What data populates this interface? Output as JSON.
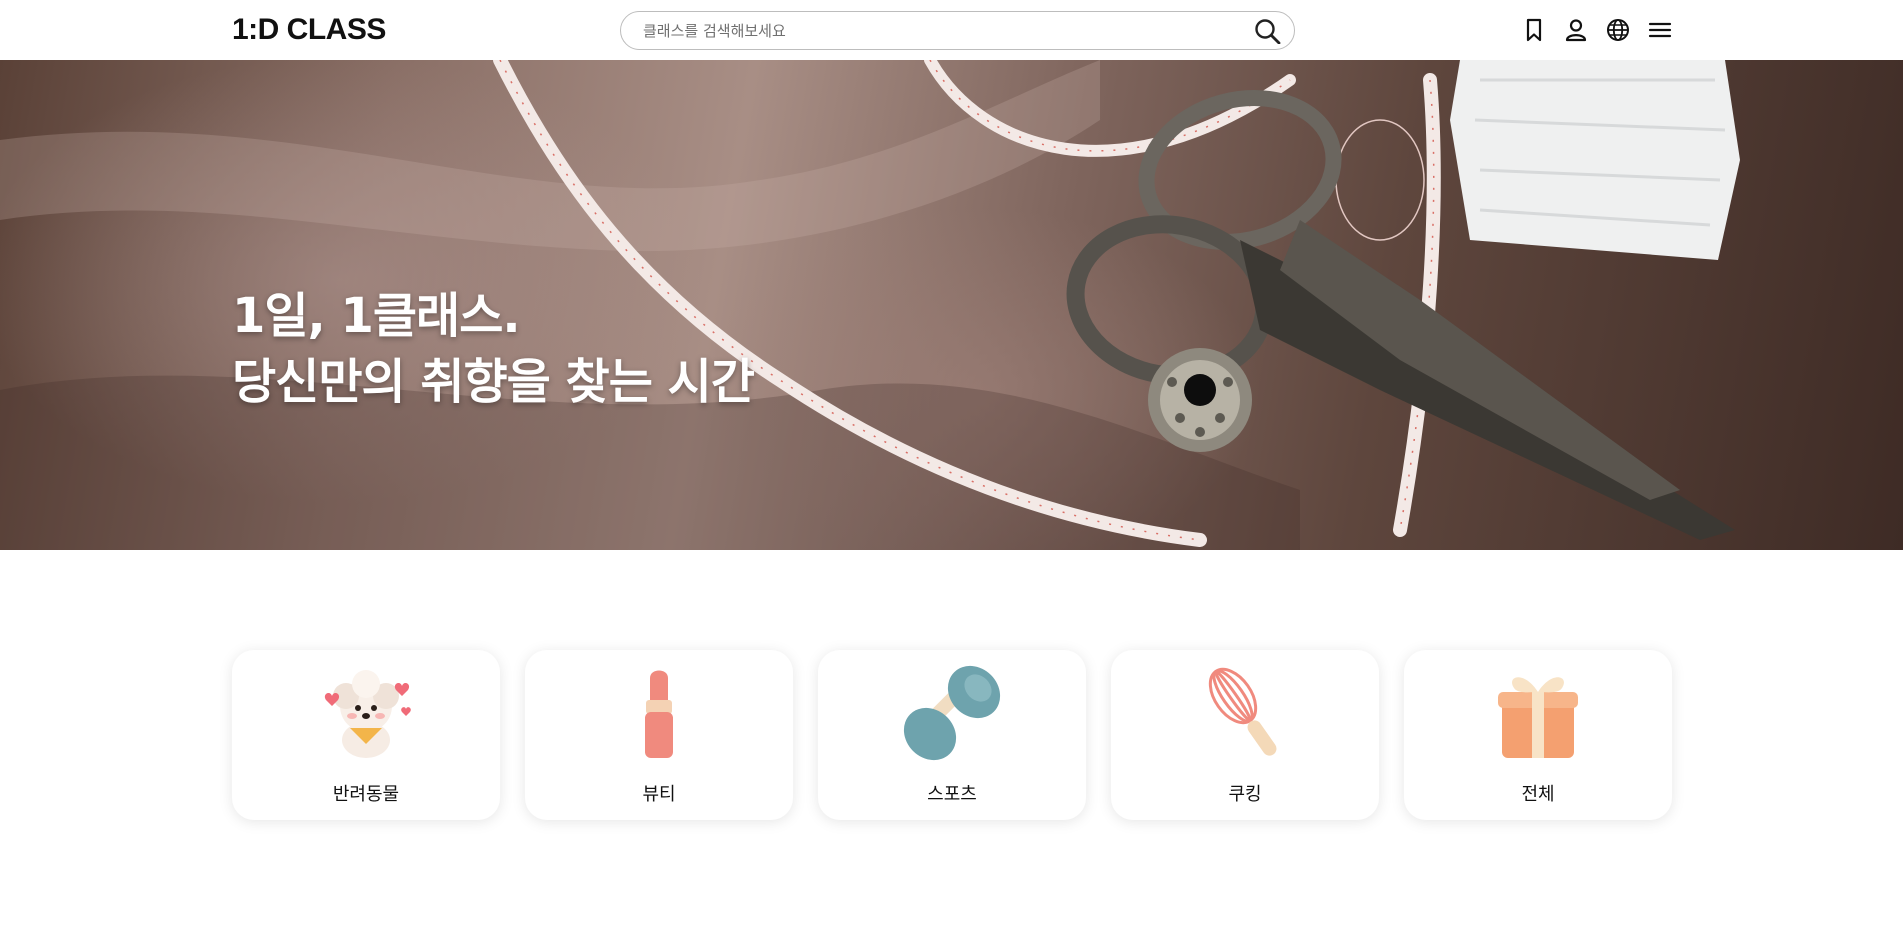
{
  "header": {
    "logo_text": "1:D CLASS",
    "search": {
      "placeholder": "클래스를 검색해보세요",
      "value": ""
    },
    "icons": [
      "bookmark-icon",
      "user-icon",
      "globe-icon",
      "menu-icon"
    ]
  },
  "hero": {
    "line1": "1일, 1클래스.",
    "line2": "당신만의 취향을 찾는 시간"
  },
  "categories": [
    {
      "label": "반려동물",
      "icon": "puppy-icon"
    },
    {
      "label": "뷰티",
      "icon": "lipstick-icon"
    },
    {
      "label": "스포츠",
      "icon": "dumbbell-icon"
    },
    {
      "label": "쿠킹",
      "icon": "whisk-icon"
    },
    {
      "label": "전체",
      "icon": "gift-icon"
    }
  ],
  "colors": {
    "accent_pink": "#f08a7e",
    "dumbbell_teal": "#6ea3ad",
    "gift_orange": "#f4a070",
    "text": "#111111"
  }
}
